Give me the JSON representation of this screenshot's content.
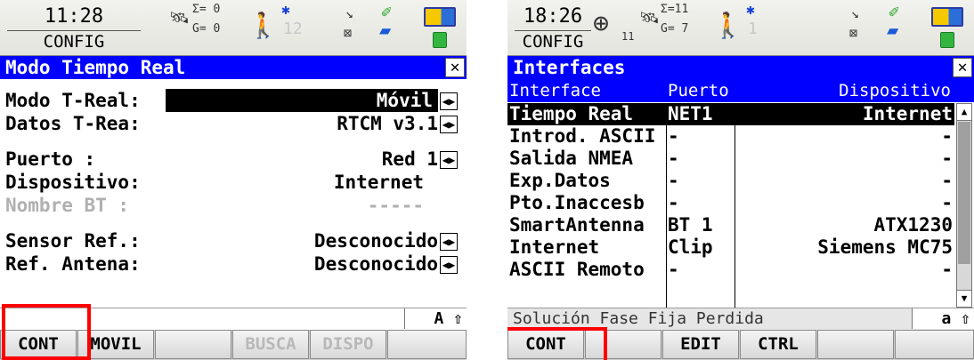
{
  "left": {
    "status": {
      "time": "11:28",
      "mode": "CONFIG",
      "sats_sigma": "Σ= 0",
      "sats_g": "G= 0",
      "count": "12"
    },
    "title": "Modo Tiempo Real",
    "rows": [
      {
        "label": "Modo T-Real:",
        "value": "Móvil"
      },
      {
        "label": "Datos T-Rea:",
        "value": "RTCM v3.1"
      },
      {
        "label": "Puerto     :",
        "value": "Red 1"
      },
      {
        "label": "Dispositivo:",
        "value": "Internet"
      },
      {
        "label": "Nombre BT  :",
        "value": "-----"
      },
      {
        "label": "Sensor Ref.:",
        "value": "Desconocido"
      },
      {
        "label": "Ref. Antena:",
        "value": "Desconocido"
      }
    ],
    "indicator": "A ⇧",
    "fkeys": [
      "CONT",
      "MOVIL",
      "",
      "BUSCA",
      "DISPO",
      ""
    ]
  },
  "right": {
    "status": {
      "time": "18:26",
      "mode": "CONFIG",
      "sats_sigma": "Σ=11",
      "sats_g": "G= 7",
      "sats_11": "11",
      "count": "1"
    },
    "title": "Interfaces",
    "headers": [
      "Interface",
      "Puerto",
      "Dispositivo"
    ],
    "rows": [
      {
        "interface": "Tiempo Real",
        "port": "NET1",
        "device": "Internet"
      },
      {
        "interface": "Introd. ASCII",
        "port": "-",
        "device": "-"
      },
      {
        "interface": "Salida NMEA",
        "port": "-",
        "device": "-"
      },
      {
        "interface": "Exp.Datos",
        "port": "-",
        "device": "-"
      },
      {
        "interface": "Pto.Inaccesb",
        "port": "-",
        "device": "-"
      },
      {
        "interface": "SmartAntenna",
        "port": "BT 1",
        "device": "ATX1230"
      },
      {
        "interface": "Internet",
        "port": "Clip",
        "device": "Siemens MC75"
      },
      {
        "interface": "ASCII Remoto",
        "port": "-",
        "device": "-"
      }
    ],
    "message": "Solución Fase Fija Perdida",
    "indicator": "a ⇧",
    "fkeys": [
      "CONT",
      "",
      "EDIT",
      "CTRL",
      "",
      ""
    ]
  },
  "colors": {
    "title_bg": "#0000ff",
    "highlight": "#ff0000"
  },
  "icons": [
    "satellite-icon",
    "walker-icon",
    "bluetooth-icon",
    "radio-icon",
    "modem-icon",
    "battery-icon",
    "plug-icon",
    "target-icon"
  ]
}
